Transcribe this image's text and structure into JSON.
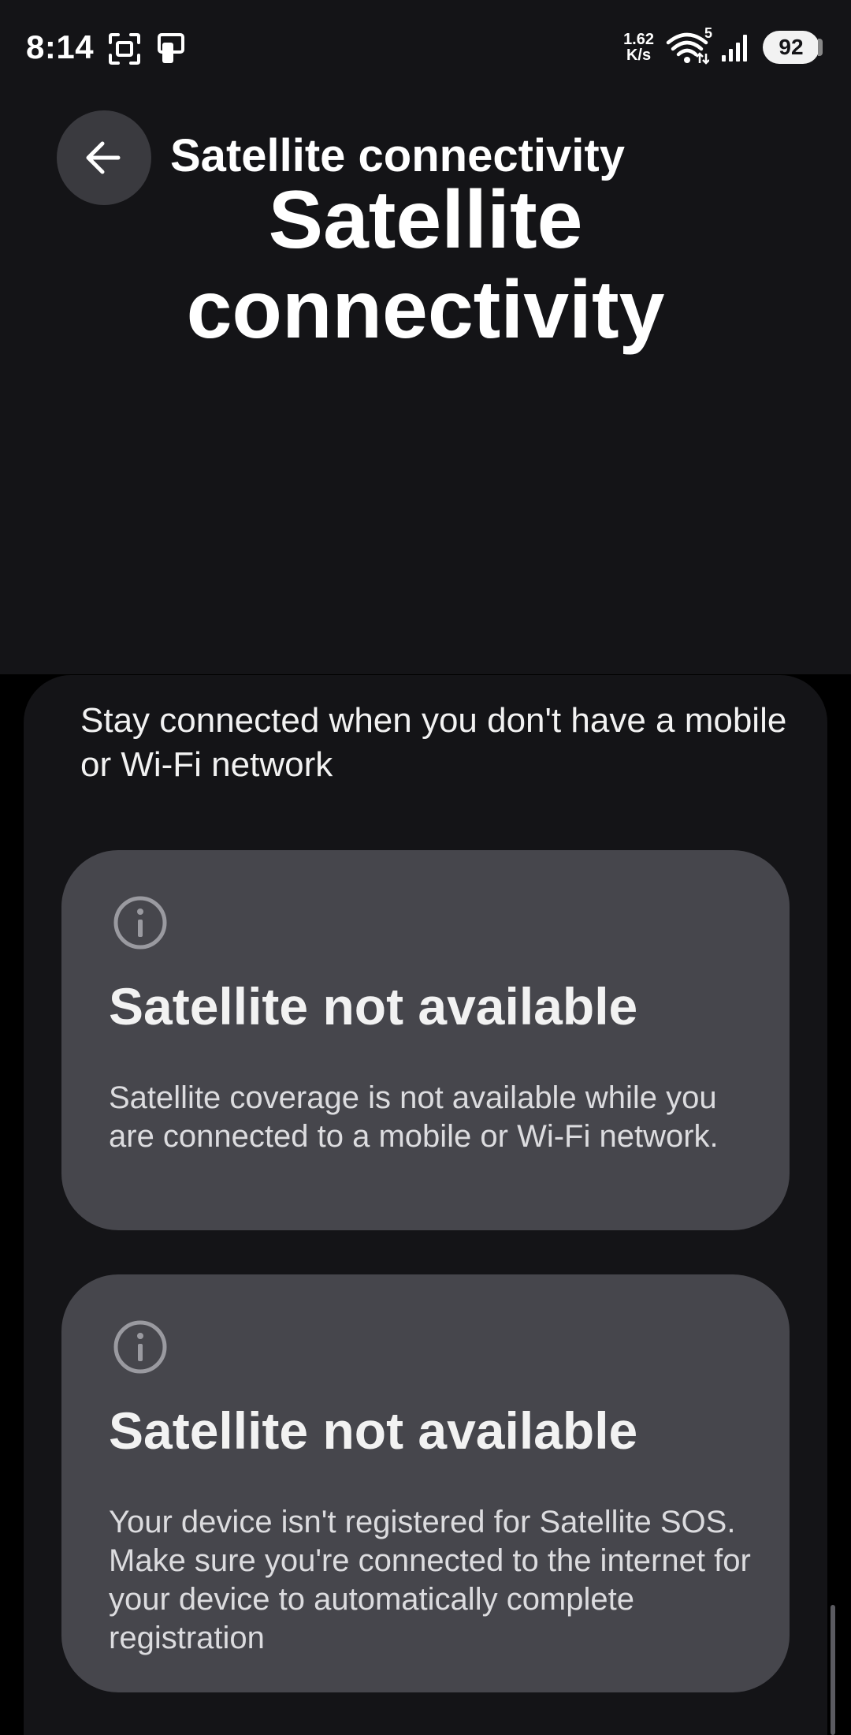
{
  "status_bar": {
    "time": "8:14",
    "net_speed_value": "1.62",
    "net_speed_unit": "K/s",
    "wifi_badge": "5",
    "battery": "92"
  },
  "header": {
    "toolbar_title": "Satellite connectivity",
    "large_title_line1": "Satellite",
    "large_title_line2": "connectivity"
  },
  "intro": "Stay connected when you don't have a mobile or Wi-Fi network",
  "cards": [
    {
      "icon": "info-icon",
      "title": "Satellite not available",
      "body": "Satellite coverage is not available while you are connected to a mobile or Wi-Fi network."
    },
    {
      "icon": "info-icon",
      "title": "Satellite not available",
      "body": "Your device isn't registered for Satellite SOS. Make sure you're connected to the internet for your device to automatically complete registration"
    }
  ],
  "colors": {
    "background": "#141417",
    "card": "#46464c",
    "back_button": "#3a3a3f",
    "text": "#ffffff"
  }
}
